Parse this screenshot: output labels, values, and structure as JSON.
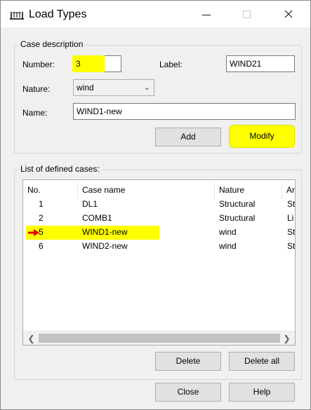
{
  "window": {
    "title": "Load Types"
  },
  "case_description": {
    "title": "Case description",
    "number_label": "Number:",
    "number_value": "3",
    "label_label": "Label:",
    "label_value": "WIND21",
    "nature_label": "Nature:",
    "nature_value": "wind",
    "name_label": "Name:",
    "name_value": "WIND1-new",
    "add_label": "Add",
    "modify_label": "Modify"
  },
  "cases_list": {
    "title": "List of defined cases:",
    "columns": [
      "No.",
      "Case name",
      "Nature",
      "An"
    ],
    "rows": [
      {
        "no": "1",
        "name": "DL1",
        "nature": "Structural",
        "extra": "St"
      },
      {
        "no": "2",
        "name": "COMB1",
        "nature": "Structural",
        "extra": "Li"
      },
      {
        "no": "5",
        "name": "WIND1-new",
        "nature": "wind",
        "extra": "St"
      },
      {
        "no": "6",
        "name": "WIND2-new",
        "nature": "wind",
        "extra": "St"
      }
    ],
    "selected_row": "5",
    "delete_label": "Delete",
    "delete_all_label": "Delete all"
  },
  "footer": {
    "close_label": "Close",
    "help_label": "Help"
  },
  "colors": {
    "highlight": "#ffff00",
    "marker": "#e00000"
  }
}
